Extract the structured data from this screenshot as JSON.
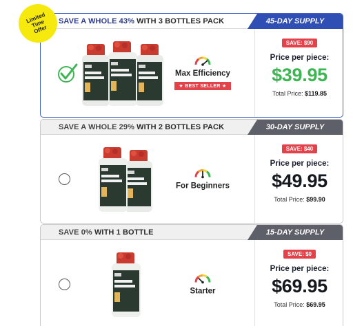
{
  "badge": {
    "lines": [
      "Limited",
      "Time",
      "Offer"
    ]
  },
  "packs": [
    {
      "title_main": "SAVE A WHOLE 43%",
      "title_sub": " WITH 3 BOTTLES PACK",
      "supply": "45-DAY SUPPLY",
      "selected": true,
      "bottle_count": 3,
      "feature": "Max Efficiency",
      "best_seller": "★ BEST SELLER ★",
      "save": "SAVE: $90",
      "per_piece_label": "Price per piece:",
      "price": "$39.95",
      "total_label": "Total Price:",
      "total": "$119.85"
    },
    {
      "title_main": "SAVE A WHOLE 29%",
      "title_sub": " WITH 2 BOTTLES PACK",
      "supply": "30-DAY SUPPLY",
      "selected": false,
      "bottle_count": 2,
      "feature": "For Beginners",
      "save": "SAVE: $40",
      "per_piece_label": "Price per piece:",
      "price": "$49.95",
      "total_label": "Total Price:",
      "total": "$99.90"
    },
    {
      "title_main": "SAVE 0%",
      "title_sub": " WITH 1 BOTTLE",
      "supply": "15-DAY SUPPLY",
      "selected": false,
      "bottle_count": 1,
      "feature": "Starter",
      "save": "SAVE: $0",
      "per_piece_label": "Price per piece:",
      "price": "$69.95",
      "total_label": "Total Price:",
      "total": "$69.95"
    }
  ],
  "bottle_label": {
    "brand": "Sunnevo Organics",
    "product_line1": "Hemp",
    "product_line2": "Gummies"
  },
  "colors": {
    "accent_blue": "#2f4fb5",
    "supply_gray": "#5d6068",
    "badge_red": "#e3424a",
    "price_green": "#3eb553",
    "check_green": "#3eb553",
    "ribbon_yellow": "#f5e90d"
  },
  "icons": [
    "checkmark-icon",
    "radio-icon",
    "gauge-icon"
  ]
}
